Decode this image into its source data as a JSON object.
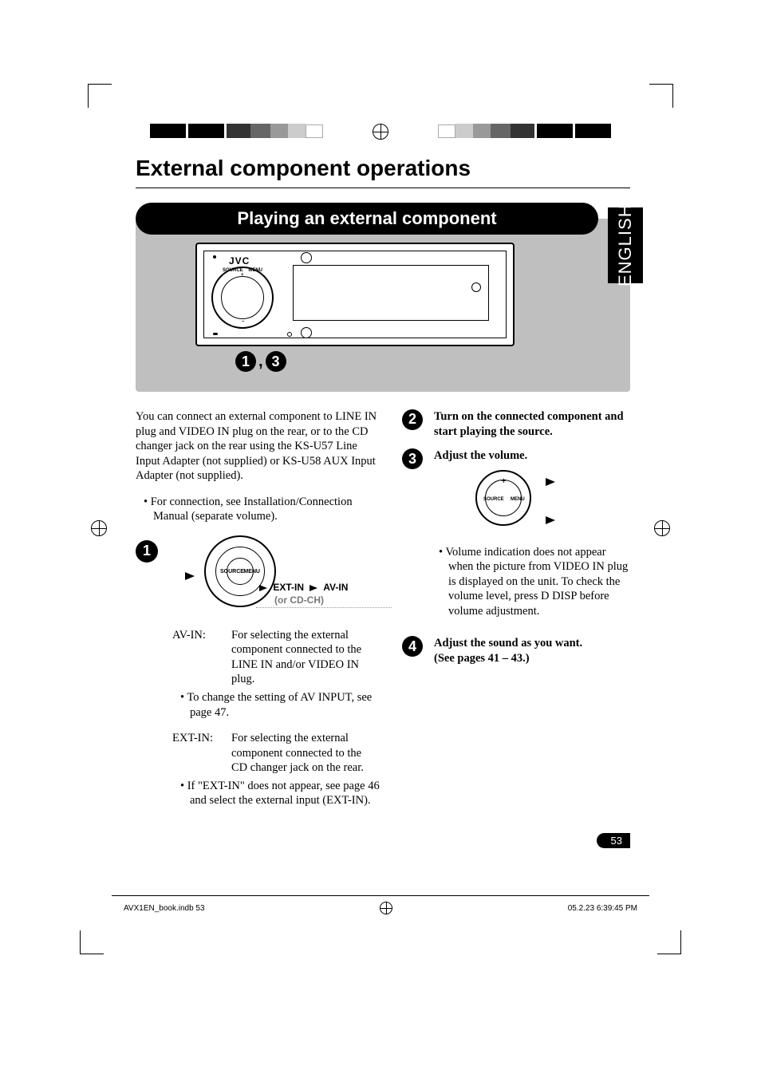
{
  "heading": "External component operations",
  "section_title": "Playing an external component",
  "language_tab": "ENGLISH",
  "device": {
    "brand": "JVC",
    "knob_left_label": "SOURCE",
    "knob_right_label": "MENU",
    "below_badge_1": "1",
    "below_comma": ",",
    "below_badge_3": "3"
  },
  "intro_para": "You can connect an external component to LINE IN plug and VIDEO IN plug on the rear, or to the CD changer jack on the rear using the KS-U57 Line Input Adapter (not supplied) or KS-U58 AUX Input Adapter (not supplied).",
  "intro_bullet": "For connection, see Installation/Connection Manual (separate volume).",
  "step1": {
    "num": "1",
    "knob_left": "SOURCE",
    "knob_right": "MENU",
    "flow_a": "EXT-IN",
    "flow_b": "AV-IN",
    "flow_sub": "(or CD-CH)",
    "avin_label": "AV-IN:",
    "avin_text": "For selecting the external component connected to the LINE IN and/or VIDEO IN plug.",
    "avin_bullet": "To change the setting of AV INPUT, see page 47.",
    "extin_label": "EXT-IN:",
    "extin_text": "For selecting the external component connected to the CD changer jack on the rear.",
    "extin_bullet": "If \"EXT-IN\" does not appear, see page 46 and select the external input (EXT-IN)."
  },
  "step2": {
    "num": "2",
    "text": "Turn on the connected component and start playing the source."
  },
  "step3": {
    "num": "3",
    "text": "Adjust the volume.",
    "knob_left": "SOURCE",
    "knob_right": "MENU",
    "bullet": "Volume indication does not appear when the picture from VIDEO IN plug is displayed on the unit. To check the volume level, press D DISP before volume adjustment."
  },
  "step4": {
    "num": "4",
    "text_a": "Adjust the sound as you want.",
    "text_b": "(See pages 41 – 43.)"
  },
  "page_number": "53",
  "footer_left": "AVX1EN_book.indb   53",
  "footer_right": "05.2.23   6:39:45 PM"
}
